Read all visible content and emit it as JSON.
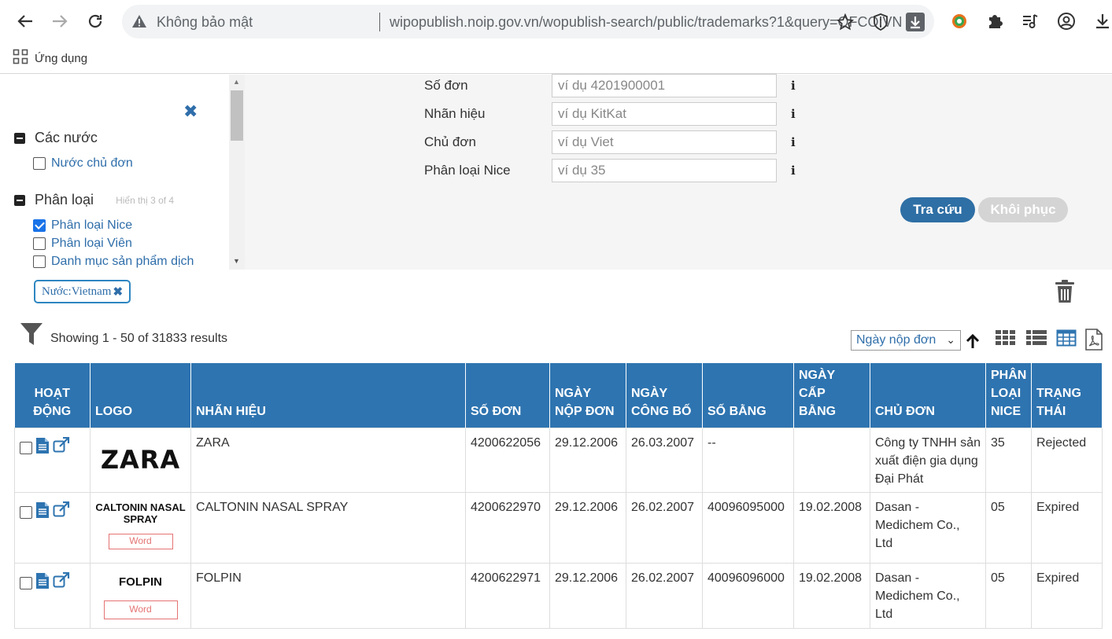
{
  "browser": {
    "security_label": "Không bảo mật",
    "url": "wipopublish.noip.gov.vn/wopublish-search/public/trademarks?1&query=OFCO:VN",
    "bookmarks_label": "Ứng dụng"
  },
  "search_form": {
    "fields": [
      {
        "label": "Số đơn",
        "placeholder": "ví dụ 4201900001",
        "info": "i"
      },
      {
        "label": "Nhãn hiệu",
        "placeholder": "ví dụ KitKat",
        "info": "i"
      },
      {
        "label": "Chủ đơn",
        "placeholder": "ví dụ Viet",
        "info": "i"
      },
      {
        "label": "Phân loại Nice",
        "placeholder": "ví dụ 35",
        "info": "i"
      }
    ],
    "search_button": "Tra cứu",
    "reset_button": "Khôi phục"
  },
  "sidebar": {
    "close_symbol": "✖",
    "facets": [
      {
        "title": "Các nước",
        "note": "",
        "items": [
          {
            "label": "Nước chủ đơn",
            "checked": false
          }
        ]
      },
      {
        "title": "Phân loại",
        "note": "Hiển thị 3 of 4",
        "items": [
          {
            "label": "Phân loại Nice",
            "checked": true
          },
          {
            "label": "Phân loại Viên",
            "checked": false
          },
          {
            "label": "Danh mục sản phẩm dịch",
            "checked": false
          }
        ]
      }
    ]
  },
  "filters": {
    "chip_label": "Nước:Vietnam",
    "chip_remove": "✖"
  },
  "results": {
    "summary": "Showing 1 - 50 of 31833 results",
    "sort_value": "Ngày nộp đơn",
    "columns": [
      "HOẠT ĐỘNG",
      "LOGO",
      "NHÃN HIỆU",
      "SỐ ĐƠN",
      "NGÀY NỘP ĐƠN",
      "NGÀY CÔNG BỐ",
      "SỐ BẰNG",
      "NGÀY CẤP BẰNG",
      "CHỦ ĐƠN",
      "PHÂN LOẠI NICE",
      "TRẠNG THÁI"
    ],
    "rows": [
      {
        "logo": "ZARA",
        "logo_word": "",
        "mark": "ZARA",
        "app_no": "4200622056",
        "filing_date": "29.12.2006",
        "pub_date": "26.03.2007",
        "reg_no": "--",
        "reg_date": "",
        "owner": "Công ty TNHH sản xuất điện gia dụng Đại Phát",
        "nice": "35",
        "status": "Rejected"
      },
      {
        "logo": "CALTONIN NASAL SPRAY",
        "logo_word": "Word",
        "mark": "CALTONIN NASAL SPRAY",
        "app_no": "4200622970",
        "filing_date": "29.12.2006",
        "pub_date": "26.02.2007",
        "reg_no": "40096095000",
        "reg_date": "19.02.2008",
        "owner": "Dasan - Medichem Co., Ltd",
        "nice": "05",
        "status": "Expired"
      },
      {
        "logo": "FOLPIN",
        "logo_word": "Word",
        "mark": "FOLPIN",
        "app_no": "4200622971",
        "filing_date": "29.12.2006",
        "pub_date": "26.02.2007",
        "reg_no": "40096096000",
        "reg_date": "19.02.2008",
        "owner": "Dasan - Medichem Co., Ltd",
        "nice": "05",
        "status": "Expired"
      }
    ]
  },
  "colors": {
    "header_blue": "#2e74b0",
    "link_blue": "#2f6eaa",
    "button_blue": "#2e6fa5"
  }
}
